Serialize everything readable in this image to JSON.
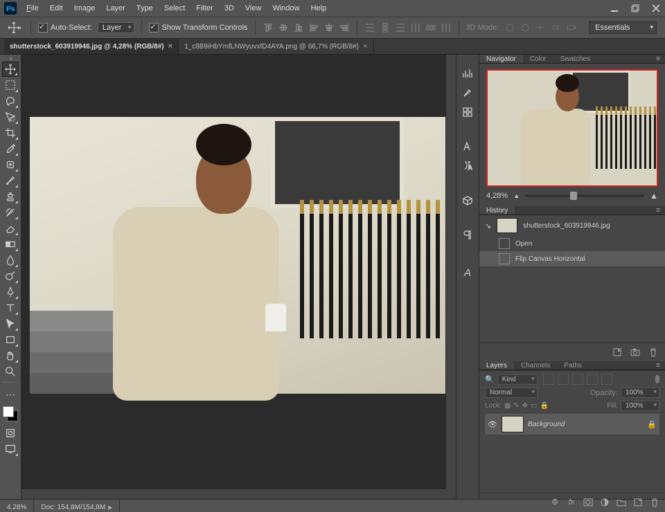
{
  "menu": {
    "file": "File",
    "edit": "Edit",
    "image": "Image",
    "layer": "Layer",
    "type": "Type",
    "select": "Select",
    "filter": "Filter",
    "threeD": "3D",
    "view": "View",
    "window": "Window",
    "help": "Help"
  },
  "optbar": {
    "autoSelect": "Auto-Select:",
    "autoSelectMode": "Layer",
    "showTransform": "Show Transform Controls",
    "threeDMode": "3D Mode:",
    "workspace": "Essentials"
  },
  "tabs": [
    {
      "label": "shutterstock_603919946.jpg @ 4,28% (RGB/8#)",
      "active": true
    },
    {
      "label": "1_c8B9iHbYmfLNWyuvxfD4AYA.png @ 66,7% (RGB/8#)",
      "active": false
    }
  ],
  "navigator": {
    "tabs": [
      "Navigator",
      "Color",
      "Swatches"
    ],
    "zoom": "4,28%"
  },
  "history": {
    "title": "History",
    "doc": "shutterstock_603919946.jpg",
    "items": [
      {
        "label": "Open",
        "sel": false
      },
      {
        "label": "Flip Canvas Horizontal",
        "sel": true
      }
    ]
  },
  "layers": {
    "tabs": [
      "Layers",
      "Channels",
      "Paths"
    ],
    "searchIcon": "🔍",
    "kind": "Kind",
    "blend": "Normal",
    "opacityLabel": "Opacity:",
    "opacity": "100%",
    "lockLabel": "Lock:",
    "fillLabel": "Fill:",
    "fill": "100%",
    "layer": {
      "name": "Background"
    }
  },
  "status": {
    "zoom": "4,28%",
    "docinfo": "Doc: 154,8M/154,8M"
  }
}
